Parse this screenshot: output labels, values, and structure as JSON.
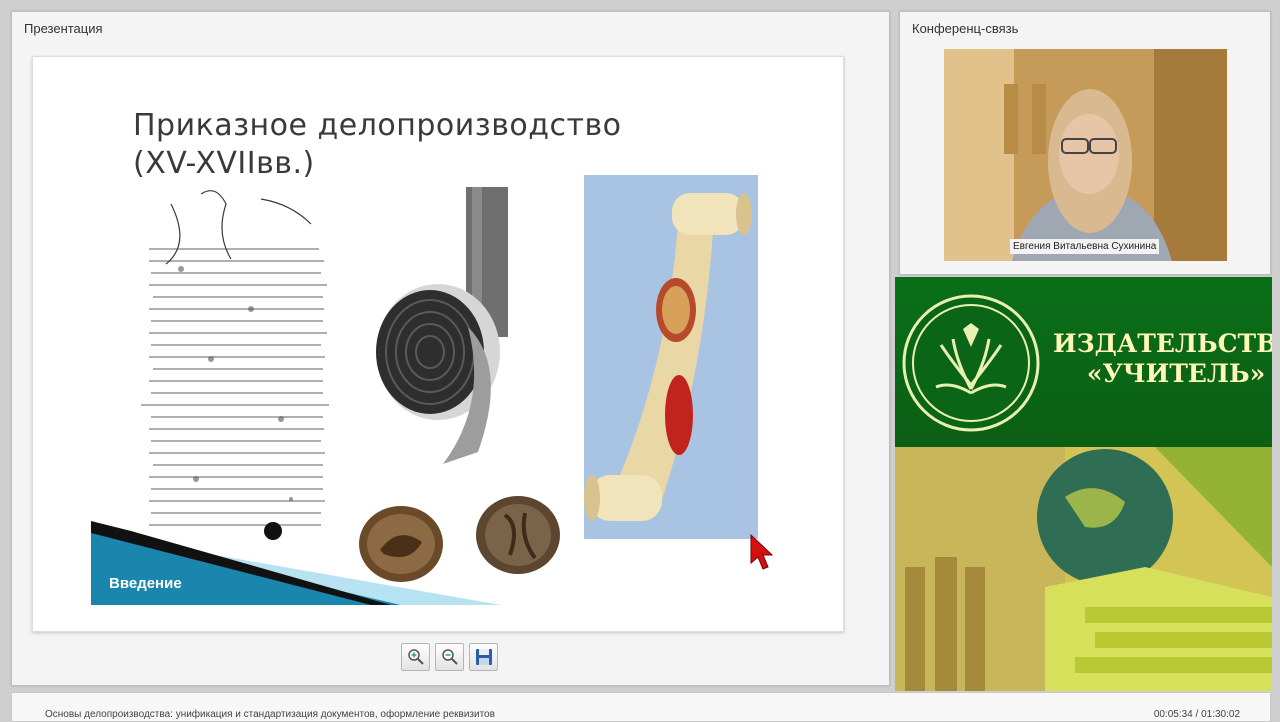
{
  "presentation_panel": {
    "title": "Презентация",
    "slide": {
      "title_line1": "Приказное делопроизводство",
      "title_line2": "(XV-XVIIвв.)",
      "section_label": "Введение"
    },
    "toolbar": {
      "zoom_in_icon": "zoom-in-icon",
      "zoom_out_icon": "zoom-out-icon",
      "save_icon": "floppy-disk-icon"
    }
  },
  "conference_panel": {
    "title": "Конференц-связь",
    "speaker_name": "Евгения Витальевна Сухинина"
  },
  "promo": {
    "publisher_line1": "ИЗДАТЕЛЬСТВО",
    "publisher_line2": "«УЧИТЕЛЬ»"
  },
  "status_bar": {
    "course_title": "Основы делопроизводства: унификация и стандартизация документов, оформление реквизитов",
    "time": "00:05:34 / 01:30:02"
  },
  "colors": {
    "promo_green": "#0b6a18",
    "promo_text": "#fff6b8",
    "slide_banner": "#1b86ad"
  }
}
